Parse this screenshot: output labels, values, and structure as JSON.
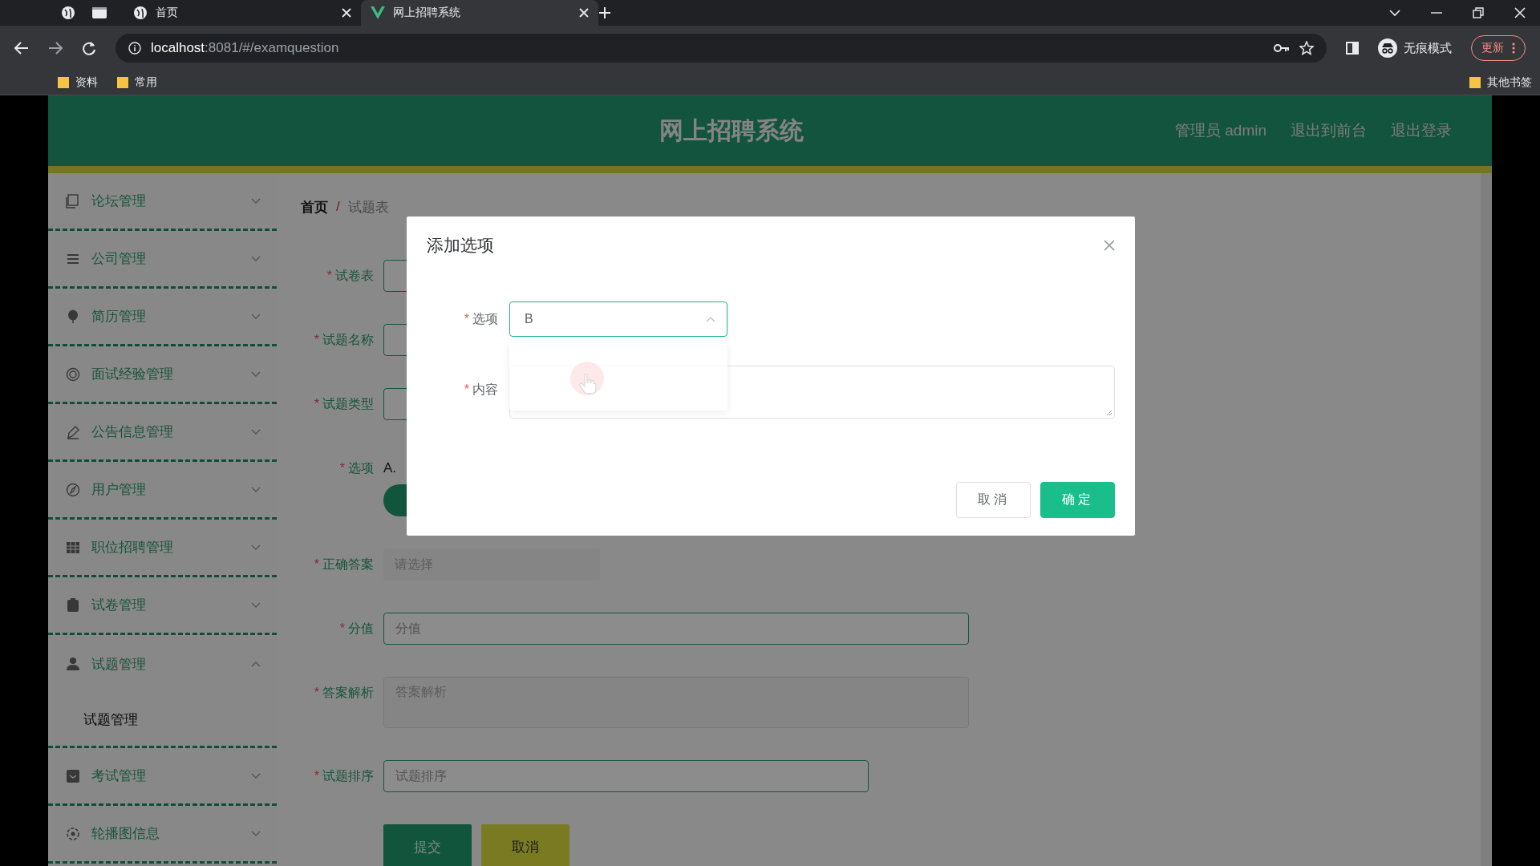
{
  "browser": {
    "tabs": [
      {
        "label": "首页",
        "kind": "globe",
        "selected": false
      },
      {
        "label": "网上招聘系统",
        "kind": "vue",
        "selected": true
      }
    ],
    "address": {
      "url_host": "localhost",
      "url_rest": ":8081/#/examquestion"
    },
    "incognito_label": "无痕模式",
    "update_button": "更新",
    "bookmarks": [
      "资料",
      "常用"
    ],
    "other_bookmarks": "其他书签"
  },
  "header": {
    "title": "网上招聘系统",
    "links": [
      "管理员 admin",
      "退出到前台",
      "退出登录"
    ]
  },
  "sidebar": {
    "items": [
      {
        "label": "论坛管理",
        "expanded": false
      },
      {
        "label": "公司管理",
        "expanded": false
      },
      {
        "label": "简历管理",
        "expanded": false
      },
      {
        "label": "面试经验管理",
        "expanded": false
      },
      {
        "label": "公告信息管理",
        "expanded": false
      },
      {
        "label": "用户管理",
        "expanded": false
      },
      {
        "label": "职位招聘管理",
        "expanded": false
      },
      {
        "label": "试卷管理",
        "expanded": false
      },
      {
        "label": "试题管理",
        "expanded": true,
        "children": [
          {
            "label": "试题管理",
            "selected": true
          }
        ]
      },
      {
        "label": "考试管理",
        "expanded": false
      },
      {
        "label": "轮播图信息",
        "expanded": false
      }
    ]
  },
  "breadcrumb": {
    "items": [
      "首页",
      "试题表"
    ],
    "separator": "/"
  },
  "form": {
    "fields": [
      {
        "label": "试卷表",
        "kind": "select",
        "required_mark": "*"
      },
      {
        "label": "试题名称",
        "kind": "input",
        "required_mark": "*"
      },
      {
        "label": "试题类型",
        "kind": "select",
        "required_mark": "*"
      },
      {
        "label": "选项",
        "kind": "options",
        "value": "A.",
        "required_mark": "*"
      },
      {
        "label": "正确答案",
        "kind": "select",
        "placeholder": "请选择",
        "required_mark": "*"
      },
      {
        "label": "分值",
        "kind": "input",
        "placeholder": "分值",
        "required_mark": "*"
      },
      {
        "label": "答案解析",
        "kind": "textarea",
        "placeholder": "答案解析",
        "required_mark": "*"
      },
      {
        "label": "试题排序",
        "kind": "input",
        "placeholder": "试题排序",
        "required_mark": "*"
      }
    ],
    "buttons": [
      {
        "label": "提交",
        "kind": "primary"
      },
      {
        "label": "取消",
        "kind": "warning"
      }
    ]
  },
  "modal": {
    "title": "添加选项",
    "fields": [
      {
        "label": "选项",
        "kind": "select",
        "value": "B",
        "open": true,
        "required_mark": "*"
      },
      {
        "label": "内容",
        "kind": "textarea",
        "required_mark": "*"
      }
    ],
    "buttons": [
      {
        "label": "取消",
        "kind": "default"
      },
      {
        "label": "确定",
        "kind": "primary"
      }
    ]
  }
}
